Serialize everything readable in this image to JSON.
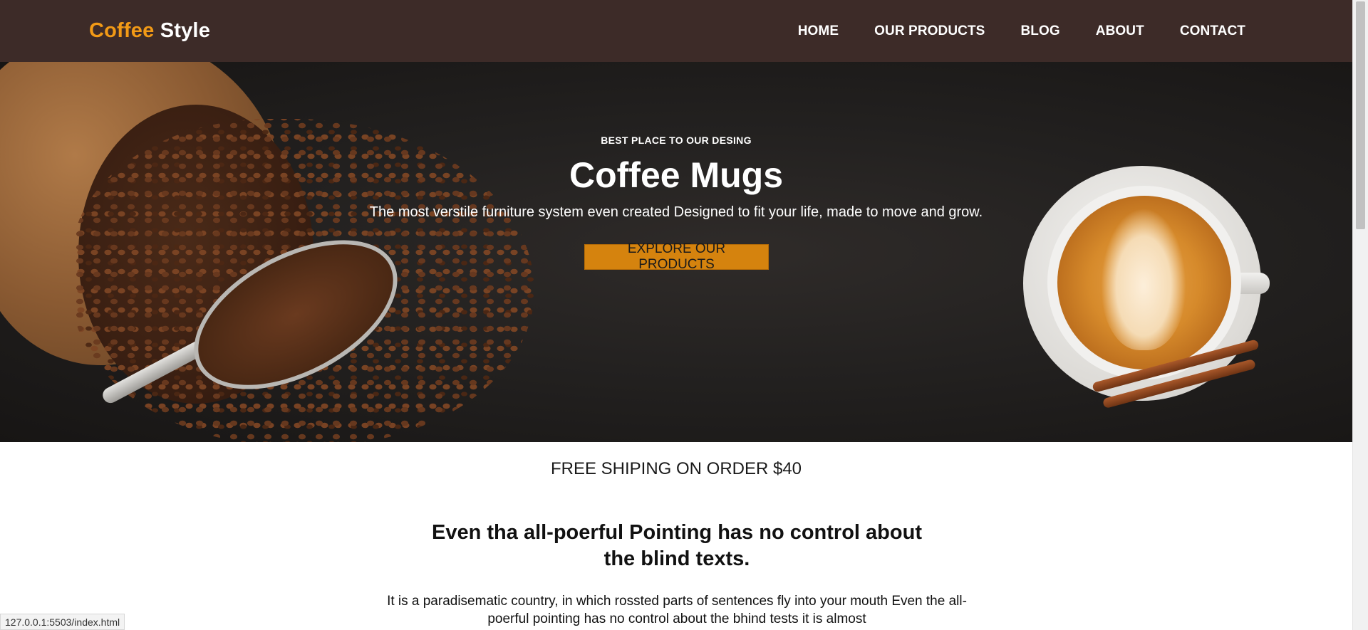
{
  "header": {
    "brand_accent": "Coffee",
    "brand_rest": "Style",
    "nav": [
      {
        "label": "HOME"
      },
      {
        "label": "OUR PRODUCTS"
      },
      {
        "label": "BLOG"
      },
      {
        "label": "ABOUT"
      },
      {
        "label": "CONTACT"
      }
    ]
  },
  "hero": {
    "eyebrow": "BEST PLACE TO OUR DESING",
    "title": "Coffee Mugs",
    "subtitle": "The most verstile furniture system even created Designed to fit your life, made to move and grow.",
    "cta_label": "EXPLORE OUR PRODUCTS"
  },
  "shipping": {
    "text": "FREE SHIPING ON ORDER $40"
  },
  "section": {
    "title": "Even tha all-poerful Pointing has no control about the blind texts.",
    "body": "It is a paradisematic country, in which rossted parts of sentences fly into your mouth Even the all-poerful pointing has no control about the bhind tests it is almost"
  },
  "status_bar": {
    "url": "127.0.0.1:5503/index.html"
  },
  "colors": {
    "nav_bg": "#3d2b28",
    "brand_accent": "#f29a16",
    "cta_bg": "#d5830e",
    "hero_bg": "#232120"
  }
}
